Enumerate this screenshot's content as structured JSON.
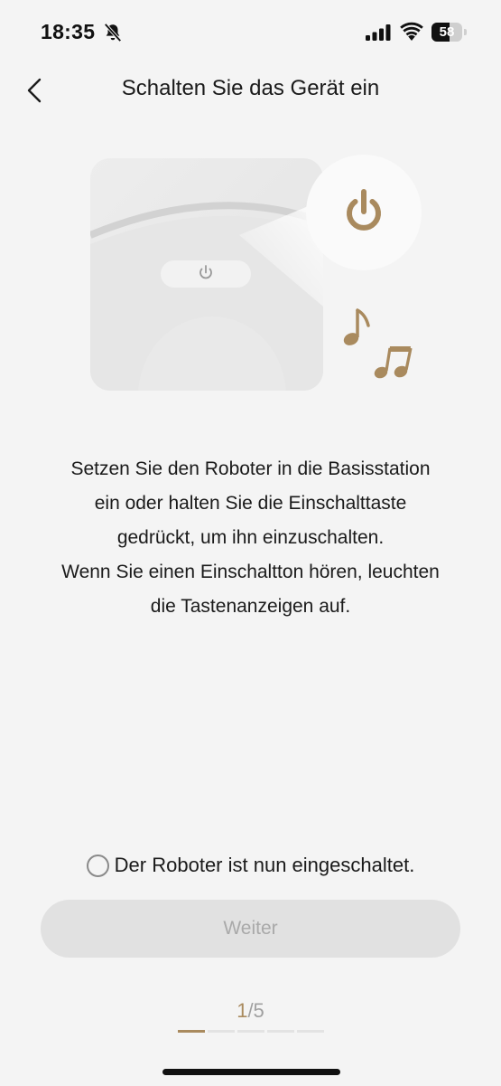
{
  "status_bar": {
    "time": "18:35",
    "battery_level": "58",
    "icons": [
      "bell-slash-icon",
      "cellular-signal-icon",
      "wifi-icon",
      "battery-icon"
    ]
  },
  "header": {
    "back_icon": "chevron-left-icon",
    "title": "Schalten Sie das Gerät ein"
  },
  "illustration": {
    "icons": [
      "robot-power-button-icon",
      "power-icon",
      "music-note-icon",
      "double-music-note-icon"
    ],
    "accent_color": "#a98a5e"
  },
  "instructions": {
    "line1": "Setzen Sie den Roboter in die Basisstation",
    "line2": "ein oder halten Sie die Einschalttaste",
    "line3": "gedrückt, um ihn einzuschalten.",
    "line4": "Wenn Sie einen Einschaltton hören, leuchten",
    "line5": "die Tastenanzeigen auf."
  },
  "confirm": {
    "label": "Der Roboter ist nun eingeschaltet.",
    "checked": false
  },
  "next_button": {
    "label": "Weiter",
    "enabled": false
  },
  "steps": {
    "current": "1",
    "total": "/5",
    "count": 5,
    "active_index": 0
  },
  "colors": {
    "accent": "#a98a5e",
    "background": "#f4f4f4",
    "button_disabled_bg": "#e1e1e1",
    "button_disabled_text": "#a9a9a9"
  }
}
